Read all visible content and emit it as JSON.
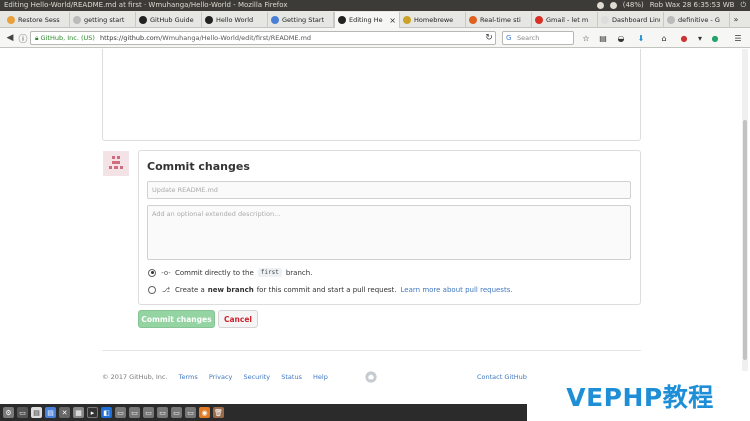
{
  "window": {
    "title": "Editing Hello-World/README.md at first · Wmuhanga/Hello-World - Mozilla Firefox",
    "battery": "(48%)",
    "clock": "Rob Wax 28  6:35:53 WB"
  },
  "tabs": [
    {
      "label": "Restore Sess",
      "color": "#e8a03a"
    },
    {
      "label": "getting start",
      "color": "#bbbbbb"
    },
    {
      "label": "GitHub Guide",
      "color": "#222222"
    },
    {
      "label": "Hello World",
      "color": "#222222"
    },
    {
      "label": "Getting Start",
      "color": "#4a7fd8"
    },
    {
      "label": "Editing He",
      "color": "#222222",
      "active": true
    },
    {
      "label": "Homebrewe",
      "color": "#c9a227"
    },
    {
      "label": "Real-time sti",
      "color": "#e0601f"
    },
    {
      "label": "Gmail - let m",
      "color": "#d93025"
    },
    {
      "label": "Dashboard Linu",
      "color": "#dddddd"
    },
    {
      "label": "definitive - G",
      "color": "#bbbbbb"
    }
  ],
  "nav": {
    "url_org": "GitHub, Inc. (US)",
    "url_host": "https://github.com",
    "url_path": "/Wmuhanga/Hello-World/edit/first/README.md",
    "search_placeholder": "Search"
  },
  "commit": {
    "title": "Commit changes",
    "summary_placeholder": "Update README.md",
    "description_placeholder": "Add an optional extended description...",
    "option_direct_prefix": "Commit directly to the",
    "option_direct_branch": "first",
    "option_direct_suffix": "branch.",
    "option_new_prefix": "Create a",
    "option_new_bold": "new branch",
    "option_new_suffix": "for this commit and start a pull request.",
    "option_new_link": "Learn more about pull requests.",
    "commit_button": "Commit changes",
    "cancel_button": "Cancel"
  },
  "footer": {
    "copyright": "© 2017 GitHub, Inc.",
    "links": [
      "Terms",
      "Privacy",
      "Security",
      "Status",
      "Help"
    ],
    "contact": "Contact GitHub"
  },
  "watermark": "VEPHP教程",
  "colors": {
    "accent_link": "#4078c0",
    "commit_button_disabled": "#94d3a2",
    "cancel_text": "#cb2431",
    "watermark": "#1e8fd6"
  }
}
